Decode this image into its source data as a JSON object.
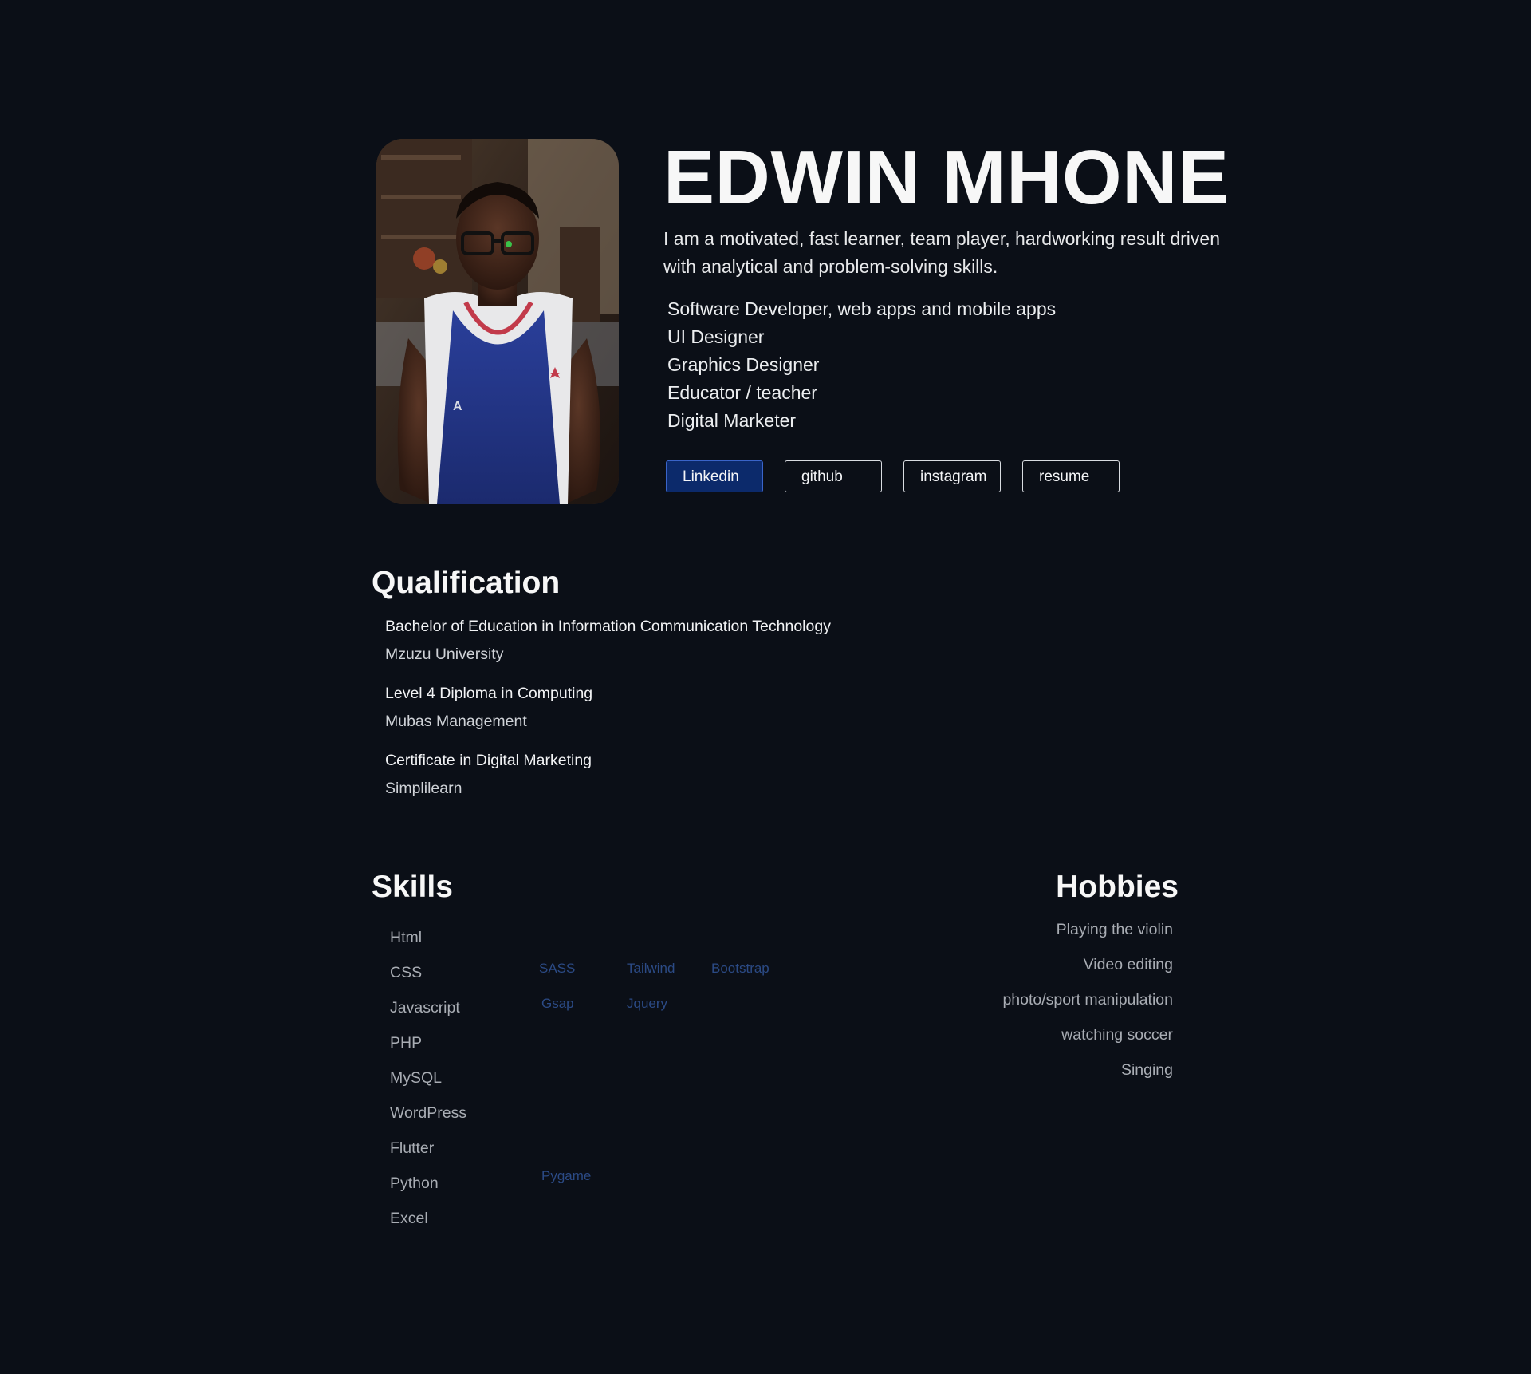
{
  "profile": {
    "name": "EDWIN MHONE",
    "intro": "I am a motivated, fast learner, team player, hardworking result driven with analytical and problem-solving skills.",
    "roles": [
      "Software Developer, web apps and mobile apps",
      "UI Designer",
      "Graphics Designer",
      "Educator / teacher",
      "Digital Marketer"
    ],
    "links": [
      {
        "label": "Linkedin"
      },
      {
        "label": "github"
      },
      {
        "label": "instagram"
      },
      {
        "label": "resume"
      }
    ]
  },
  "qualification": {
    "title": "Qualification",
    "items": [
      {
        "degree": "Bachelor of Education in Information Communication Technology",
        "school": "Mzuzu University"
      },
      {
        "degree": "Level 4  Diploma in Computing",
        "school": "Mubas Management"
      },
      {
        "degree": "Certificate in Digital Marketing",
        "school": "Simplilearn"
      }
    ]
  },
  "skills": {
    "title": "Skills",
    "items": [
      "Html",
      "CSS",
      "Javascript",
      "PHP",
      "MySQL",
      "WordPress",
      "Flutter",
      "Python",
      "Excel"
    ],
    "sub": {
      "css": [
        "SASS",
        "Tailwind",
        "Bootstrap"
      ],
      "javascript": [
        "Gsap",
        "Jquery"
      ],
      "python": [
        "Pygame"
      ]
    }
  },
  "hobbies": {
    "title": "Hobbies",
    "items": [
      "Playing the violin",
      "Video editing",
      "photo/sport manipulation",
      "watching soccer",
      "Singing"
    ]
  },
  "colors": {
    "background": "#0b0f17",
    "heading": "#f7f7f7",
    "muted": "#a9adb4",
    "sub_skill": "#2b4a85",
    "active_button": "#0c2a6b"
  }
}
